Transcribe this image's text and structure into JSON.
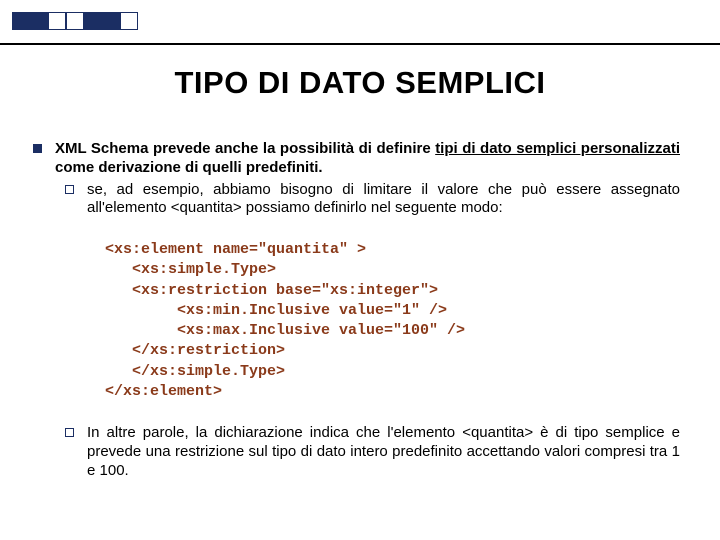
{
  "title": "TIPO DI DATO SEMPLICI",
  "body": {
    "p1_pre": "XML Schema prevede anche la possibilità di definire ",
    "p1_em": "tipi di dato semplici personalizzati",
    "p1_post": " come derivazione di quelli predefiniti.",
    "sub1": "se, ad esempio, abbiamo bisogno di limitare il valore che può essere assegnato all'elemento <quantita> possiamo definirlo nel seguente modo:",
    "code": "<xs:element name=\"quantita\" >\n   <xs:simple.Type>\n   <xs:restriction base=\"xs:integer\">\n        <xs:min.Inclusive value=\"1\" />\n        <xs:max.Inclusive value=\"100\" />\n   </xs:restriction>\n   </xs:simple.Type>\n</xs:element>",
    "sub2": "In altre parole, la dichiarazione indica che l'elemento <quantita> è di tipo semplice e prevede una restrizione sul tipo di dato intero predefinito accettando valori compresi tra 1 e 100."
  }
}
